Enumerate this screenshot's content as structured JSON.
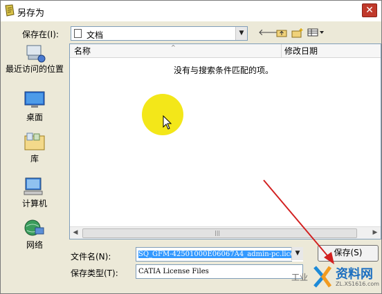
{
  "window": {
    "title": "另存为"
  },
  "save_in": {
    "label": "保存在(I):",
    "value": "文档"
  },
  "places": [
    {
      "label": "最近访问的位置",
      "icon": "recent-places-icon"
    },
    {
      "label": "桌面",
      "icon": "desktop-icon"
    },
    {
      "label": "库",
      "icon": "library-icon"
    },
    {
      "label": "计算机",
      "icon": "computer-icon"
    },
    {
      "label": "网络",
      "icon": "network-icon"
    }
  ],
  "file_list": {
    "columns": [
      {
        "label": "名称"
      },
      {
        "label": "修改日期"
      }
    ],
    "empty_message": "没有与搜索条件匹配的项。"
  },
  "filename": {
    "label": "文件名(N):",
    "value": "SQ_GFM-42501000E06067A4_admin-pc.lice"
  },
  "filetype": {
    "label": "保存类型(T):",
    "value": "CATIA License Files"
  },
  "buttons": {
    "save": "保存(S)"
  },
  "watermark": {
    "text": "资料网",
    "url_text": "ZL.XS1616.com",
    "side_text": "工业"
  },
  "colors": {
    "highlight": "#f2e400",
    "arrow": "#d22020",
    "selection": "#3399ff"
  }
}
